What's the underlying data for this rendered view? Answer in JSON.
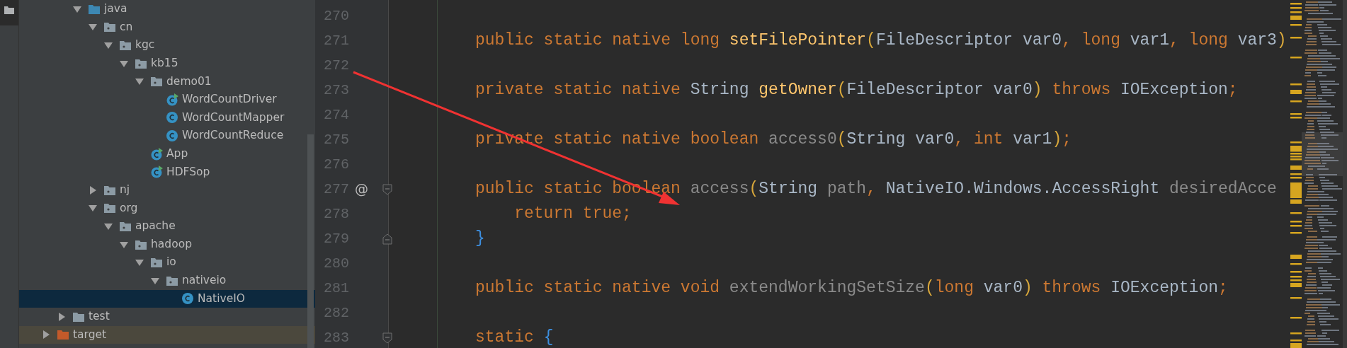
{
  "tree": {
    "items": [
      {
        "children": [
          {
            "children": [
              {
                "label": "java",
                "kind": "source_folder",
                "expanded": true,
                "selected": false,
                "children": [
                  {
                    "label": "cn",
                    "kind": "package",
                    "expanded": true,
                    "selected": false,
                    "children": [
                      {
                        "label": "kgc",
                        "kind": "package",
                        "expanded": true,
                        "selected": false,
                        "children": [
                          {
                            "label": "kb15",
                            "kind": "package",
                            "expanded": true,
                            "selected": false,
                            "children": [
                              {
                                "label": "demo01",
                                "kind": "package",
                                "expanded": true,
                                "selected": false,
                                "children": [
                                  {
                                    "label": "WordCountDriver",
                                    "kind": "runnable_class",
                                    "selected": false
                                  },
                                  {
                                    "label": "WordCountMapper",
                                    "kind": "class",
                                    "selected": false
                                  },
                                  {
                                    "label": "WordCountReduce",
                                    "kind": "class",
                                    "selected": false
                                  }
                                ]
                              },
                              {
                                "label": "App",
                                "kind": "runnable_class",
                                "selected": false
                              },
                              {
                                "label": "HDFSop",
                                "kind": "runnable_class",
                                "selected": false
                              }
                            ]
                          }
                        ]
                      }
                    ]
                  },
                  {
                    "label": "nj",
                    "kind": "package",
                    "expanded": false,
                    "selected": false
                  },
                  {
                    "label": "org",
                    "kind": "package",
                    "expanded": true,
                    "selected": false,
                    "children": [
                      {
                        "label": "apache",
                        "kind": "package",
                        "expanded": true,
                        "selected": false,
                        "children": [
                          {
                            "label": "hadoop",
                            "kind": "package",
                            "expanded": true,
                            "selected": false,
                            "children": [
                              {
                                "label": "io",
                                "kind": "package",
                                "expanded": true,
                                "selected": false,
                                "children": [
                                  {
                                    "label": "nativeio",
                                    "kind": "package",
                                    "expanded": true,
                                    "selected": false,
                                    "children": [
                                      {
                                        "label": "NativeIO",
                                        "kind": "class",
                                        "selected": true
                                      }
                                    ]
                                  }
                                ]
                              }
                            ]
                          }
                        ]
                      }
                    ]
                  }
                ]
              }
            ]
          },
          {
            "label": "test",
            "kind": "folder",
            "expanded": false,
            "selected": false
          }
        ]
      },
      {
        "label": "target",
        "kind": "excluded_folder",
        "expanded": false,
        "selected": false
      }
    ]
  },
  "editor": {
    "lines": [
      {
        "number": "270"
      },
      {
        "number": "271",
        "tokens": [
          {
            "kind": "k",
            "text": "public static native long "
          },
          {
            "kind": "f",
            "text": "setFilePointer"
          },
          {
            "kind": "p",
            "text": "("
          },
          {
            "kind": "t",
            "text": "FileDescriptor var0"
          },
          {
            "kind": "k",
            "text": ", long "
          },
          {
            "kind": "t",
            "text": "var1"
          },
          {
            "kind": "k",
            "text": ", long "
          },
          {
            "kind": "t",
            "text": "var3"
          },
          {
            "kind": "p",
            "text": ")"
          }
        ]
      },
      {
        "number": "272"
      },
      {
        "number": "273",
        "tokens": [
          {
            "kind": "k",
            "text": "private static native "
          },
          {
            "kind": "t",
            "text": "String "
          },
          {
            "kind": "f",
            "text": "getOwner"
          },
          {
            "kind": "p",
            "text": "("
          },
          {
            "kind": "t",
            "text": "FileDescriptor var0"
          },
          {
            "kind": "p",
            "text": ")"
          },
          {
            "kind": "k",
            "text": " throws "
          },
          {
            "kind": "t",
            "text": "IOException"
          },
          {
            "kind": "k",
            "text": ";"
          }
        ]
      },
      {
        "number": "274"
      },
      {
        "number": "275",
        "tokens": [
          {
            "kind": "k",
            "text": "private static native boolean "
          },
          {
            "kind": "u",
            "text": "access0"
          },
          {
            "kind": "p",
            "text": "("
          },
          {
            "kind": "t",
            "text": "String var0"
          },
          {
            "kind": "k",
            "text": ", int "
          },
          {
            "kind": "t",
            "text": "var1"
          },
          {
            "kind": "p",
            "text": ")"
          },
          {
            "kind": "k",
            "text": ";"
          }
        ]
      },
      {
        "number": "276"
      },
      {
        "number": "277",
        "gutter_mark": "@",
        "kind": "fold_start",
        "tokens": [
          {
            "kind": "k",
            "text": "public static boolean "
          },
          {
            "kind": "u",
            "text": "access"
          },
          {
            "kind": "p",
            "text": "("
          },
          {
            "kind": "t",
            "text": "String "
          },
          {
            "kind": "u",
            "text": "path"
          },
          {
            "kind": "k",
            "text": ", "
          },
          {
            "kind": "t",
            "text": "NativeIO.Windows.AccessRight "
          },
          {
            "kind": "u",
            "text": "desiredAcce"
          }
        ]
      },
      {
        "number": "278",
        "tokens": [
          {
            "kind": "k",
            "text": "    return true;"
          }
        ]
      },
      {
        "number": "279",
        "kind": "fold_end",
        "tokens": [
          {
            "kind": "b",
            "text": "}"
          }
        ]
      },
      {
        "number": "280"
      },
      {
        "number": "281",
        "tokens": [
          {
            "kind": "k",
            "text": "public static native void "
          },
          {
            "kind": "u",
            "text": "extendWorkingSetSize"
          },
          {
            "kind": "p",
            "text": "("
          },
          {
            "kind": "k",
            "text": "long "
          },
          {
            "kind": "t",
            "text": "var0"
          },
          {
            "kind": "p",
            "text": ")"
          },
          {
            "kind": "k",
            "text": " throws "
          },
          {
            "kind": "t",
            "text": "IOException"
          },
          {
            "kind": "k",
            "text": ";"
          }
        ]
      },
      {
        "number": "282"
      },
      {
        "number": "283",
        "kind": "fold_start",
        "tokens": [
          {
            "kind": "k",
            "text": "static "
          },
          {
            "kind": "b",
            "text": "{"
          }
        ]
      }
    ]
  },
  "annotations": [
    {
      "kind": "arrow"
    }
  ]
}
